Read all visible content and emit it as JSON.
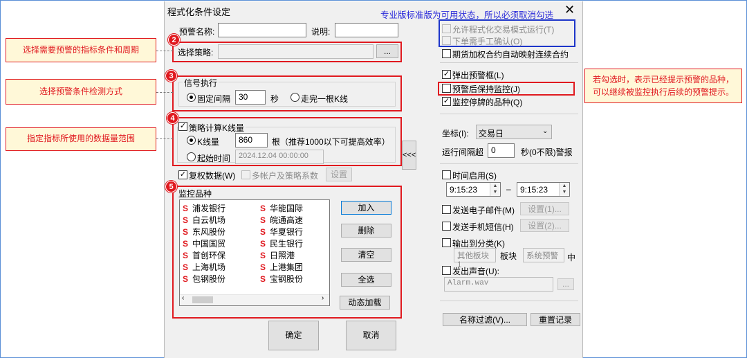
{
  "dialog": {
    "title": "程式化条件设定",
    "top_hint": "专业版标准版为可用状态，所以必须取消勾选",
    "close": "✕"
  },
  "form": {
    "alert_name_label": "预警名称:",
    "alert_name_value": "",
    "description_label": "说明:",
    "description_value": "",
    "strategy_label": "选择策略:",
    "strategy_value": "",
    "browse_button": "...",
    "signal_group": "信号执行",
    "fixed_interval_label": "固定间隔",
    "fixed_interval_value": "30",
    "seconds_unit": "秒",
    "per_bar_label": "走完一根K线",
    "calc_bars_label": "策略计算K线量",
    "bars_label": "K线量",
    "bars_value": "860",
    "bars_hint": "根（推荐1000以下可提高效率）",
    "start_time_label": "起始时间",
    "start_time_value": "2024.12.04 00:00:00",
    "collapse_button": "<<<",
    "adjusted_label": "复权数据(W)",
    "multi_account_label": "多帐户及策略系数",
    "settings_button": "设置",
    "monitor_group": "监控品种",
    "stock_marker": "S",
    "stocks_col1": [
      "浦发银行",
      "白云机场",
      "东风股份",
      "中国国贸",
      "首创环保",
      "上海机场",
      "包钢股份"
    ],
    "stocks_col2": [
      "华能国际",
      "皖通高速",
      "华夏银行",
      "民生银行",
      "日照港",
      "上港集团",
      "宝钢股份"
    ],
    "add_button": "加入",
    "delete_button": "删除",
    "clear_button": "清空",
    "select_all_button": "全选",
    "dynamic_load_button": "动态加载",
    "ok_button": "确定",
    "cancel_button": "取消"
  },
  "right": {
    "allow_auto_trade": "允许程式化交易模式运行(T)",
    "manual_confirm": "下单需手工确认(O)",
    "futures_map": "期货加权合约自动映射连续合约",
    "popup_alert": "弹出预警框(L)",
    "keep_monitor": "预警后保持监控(J)",
    "monitor_suspended": "监控停牌的品种(Q)",
    "axis_label": "坐标(I):",
    "axis_value": "交易日",
    "interval_label": "运行间隔超",
    "interval_value": "0",
    "interval_suffix": "秒(0不限)警报",
    "time_enable": "时间启用(S)",
    "time_start": "9:15:23",
    "time_dash": "–",
    "time_end": "9:15:23",
    "send_email": "发送电子邮件(M)",
    "email_settings": "设置(1)...",
    "send_sms": "发送手机短信(H)",
    "sms_settings": "设置(2)...",
    "output_category": "输出到分类(K)",
    "category_value": "其他板块1",
    "block_label": "板块",
    "block_value": "系统预警",
    "middle_suffix": "中",
    "sound": "发出声音(U):",
    "sound_file": "Alarm.wav",
    "sound_browse": "...",
    "name_filter": "名称过滤(V)...",
    "reset_log": "重置记录"
  },
  "callouts": {
    "c2": "选择需要预警的指标条件和周期",
    "c3": "选择预警条件检测方式",
    "c4": "指定指标所使用的数据量范围",
    "right_note": "若勾选时，表示已经提示预警的品种，可以继续被监控执行后续的预警提示。",
    "n2": "2",
    "n3": "3",
    "n4": "4",
    "n5": "5"
  },
  "colors": {
    "annotation_red": "#e0191f",
    "annotation_blue": "#1d35c9",
    "hint_blue": "#2b2bd9"
  }
}
